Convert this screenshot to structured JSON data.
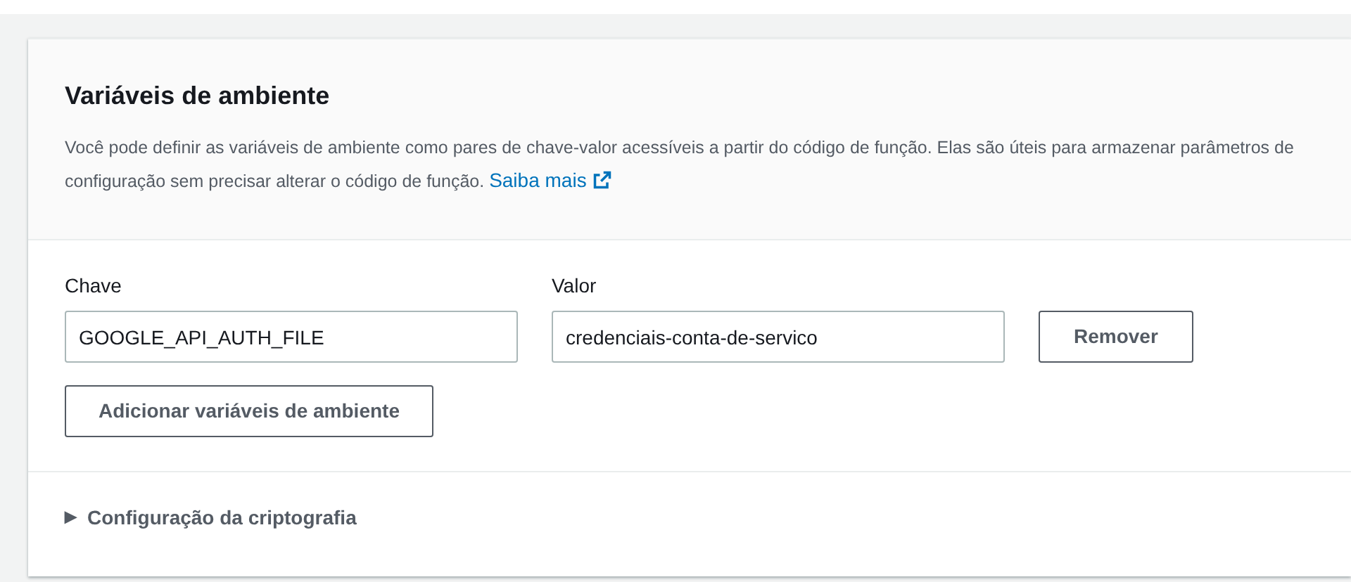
{
  "panel": {
    "title": "Variáveis de ambiente",
    "description": "Você pode definir as variáveis de ambiente como pares de chave-valor acessíveis a partir do código de função. Elas são úteis para armazenar parâmetros de configuração sem precisar alterar o código de função.",
    "learn_more": "Saiba mais"
  },
  "columns": [
    "Chave",
    "Valor"
  ],
  "variables": [
    {
      "key": "GOOGLE_API_AUTH_FILE",
      "value": "credenciais-conta-de-servico",
      "remove_button": "Remover"
    }
  ],
  "add_button": "Adicionar variáveis de ambiente",
  "encryption_section": {
    "toggle": "▶",
    "label": "Configuração da criptografia",
    "expanded": false
  }
}
